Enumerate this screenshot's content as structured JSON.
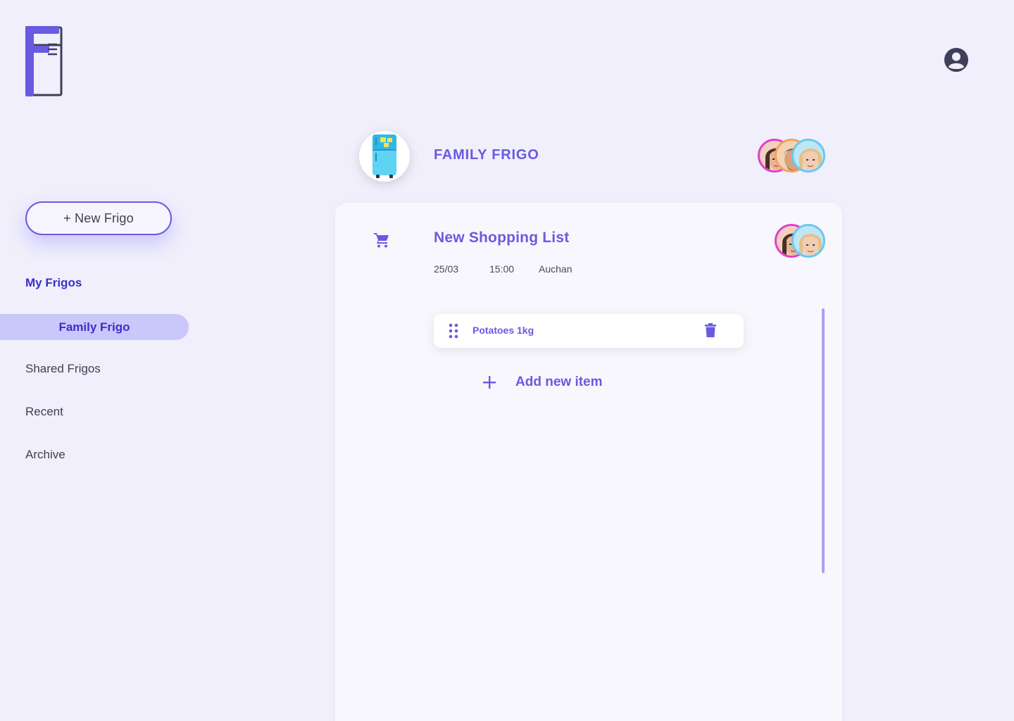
{
  "brand": {
    "logo_icon": "fridge-logo-icon"
  },
  "header": {
    "profile_icon": "account-circle-icon"
  },
  "sidebar": {
    "new_button_label": "+ New Frigo",
    "section_title": "My Frigos",
    "active_item": "Family Frigo",
    "items": [
      "Shared Frigos",
      "Recent",
      "Archive"
    ]
  },
  "frigo": {
    "title": "FAMILY FRIGO",
    "icon": "fridge-icon",
    "members": [
      "member-avatar",
      "member-avatar",
      "member-avatar"
    ]
  },
  "list": {
    "icon": "shopping-cart-icon",
    "title": "New Shopping List",
    "date": "25/03",
    "time": "15:00",
    "store": "Auchan",
    "members": [
      "member-avatar",
      "member-avatar"
    ],
    "items": [
      {
        "label": "Potatoes 1kg"
      }
    ],
    "add_label": "Add new item"
  },
  "colors": {
    "accent": "#6a5ae0",
    "accent_dark": "#3b2ec9",
    "background": "#f0effb",
    "active_nav": "#cac7fa"
  }
}
